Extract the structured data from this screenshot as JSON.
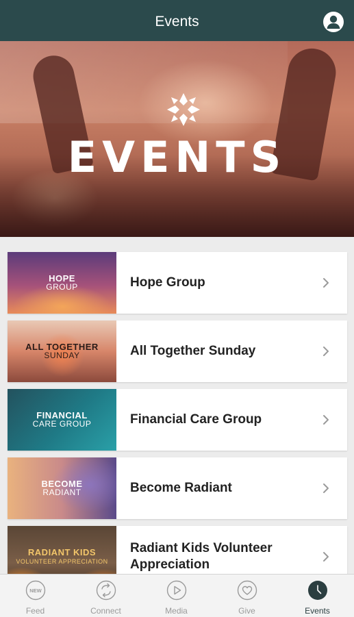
{
  "header": {
    "title": "Events",
    "profile_icon": "user-icon"
  },
  "hero": {
    "title": "EVENTS",
    "logo_icon": "church-logo-icon"
  },
  "events": [
    {
      "label": "Hope Group",
      "thumb_line1": "HOPE",
      "thumb_line2": "GROUP"
    },
    {
      "label": "All Together Sunday",
      "thumb_line1": "ALL TOGETHER",
      "thumb_line2": "SUNDAY"
    },
    {
      "label": "Financial Care Group",
      "thumb_line1": "FINANCIAL",
      "thumb_line2": "CARE GROUP"
    },
    {
      "label": "Become Radiant",
      "thumb_line1": "BECOME",
      "thumb_line2": "RADIANT"
    },
    {
      "label": "Radiant Kids Volunteer Appreciation",
      "thumb_line1": "RADIANT KIDS",
      "thumb_line2": "VOLUNTEER APPRECIATION"
    }
  ],
  "tabs": [
    {
      "label": "Feed",
      "icon": "new-badge-icon",
      "icon_text": "NEW"
    },
    {
      "label": "Connect",
      "icon": "connect-arrows-icon"
    },
    {
      "label": "Media",
      "icon": "play-icon"
    },
    {
      "label": "Give",
      "icon": "heart-icon"
    },
    {
      "label": "Events",
      "icon": "clock-icon"
    }
  ],
  "colors": {
    "header_bg": "#2b4a4c",
    "active_tab": "#2b3e40",
    "inactive_tab": "#9a9a9a"
  }
}
